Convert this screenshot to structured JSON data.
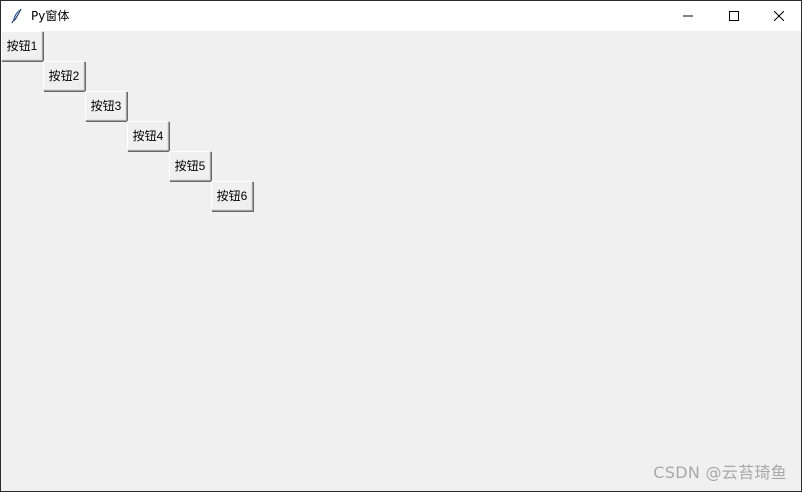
{
  "window": {
    "title": "Py窗体",
    "controls": {
      "minimize_icon": "minimize-icon",
      "maximize_icon": "maximize-icon",
      "close_icon": "close-icon"
    }
  },
  "buttons": [
    {
      "label": "按钮1"
    },
    {
      "label": "按钮2"
    },
    {
      "label": "按钮3"
    },
    {
      "label": "按钮4"
    },
    {
      "label": "按钮5"
    },
    {
      "label": "按钮6"
    }
  ],
  "watermark": {
    "text": "CSDN @云苔琦鱼"
  },
  "colors": {
    "window_bg": "#f0f0f0",
    "titlebar_bg": "#ffffff",
    "watermark": "#a8a8a8"
  }
}
